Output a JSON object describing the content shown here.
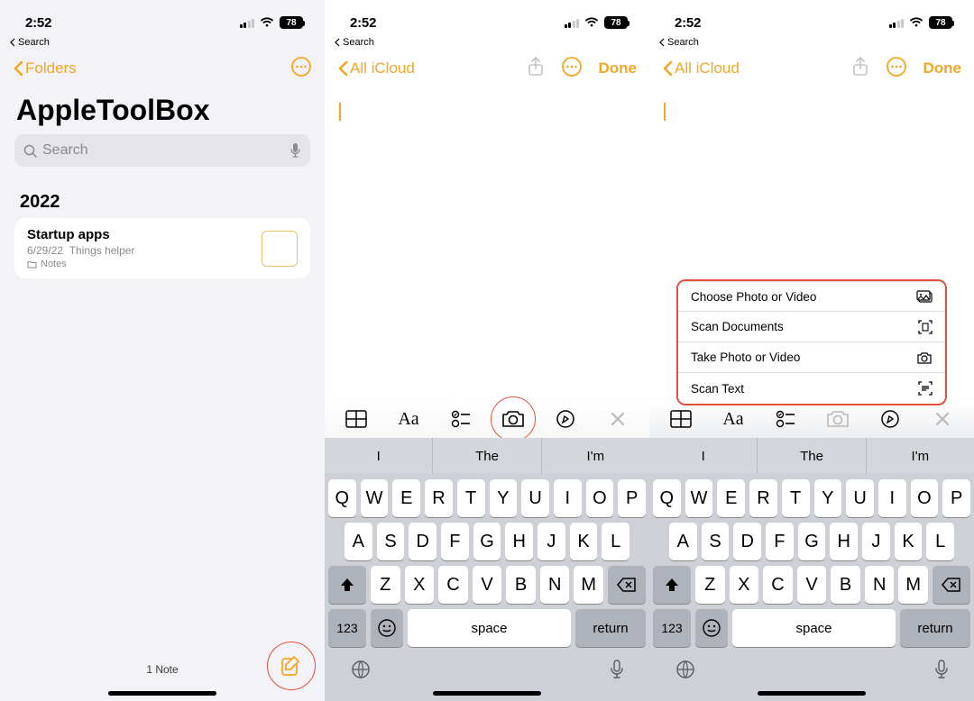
{
  "status": {
    "time": "2:52",
    "battery": "78"
  },
  "back_search": "Search",
  "screen1": {
    "back_label": "Folders",
    "title": "AppleToolBox",
    "search_placeholder": "Search",
    "year": "2022",
    "note": {
      "title": "Startup apps",
      "date": "6/29/22",
      "preview": "Things helper",
      "folder": "Notes"
    },
    "note_count": "1 Note"
  },
  "editor": {
    "back_label": "All iCloud",
    "done": "Done",
    "toolbar": {
      "aa": "Aa"
    },
    "suggestions": [
      "I",
      "The",
      "I'm"
    ],
    "keys_row1": [
      "Q",
      "W",
      "E",
      "R",
      "T",
      "Y",
      "U",
      "I",
      "O",
      "P"
    ],
    "keys_row2": [
      "A",
      "S",
      "D",
      "F",
      "G",
      "H",
      "J",
      "K",
      "L"
    ],
    "keys_row3": [
      "Z",
      "X",
      "C",
      "V",
      "B",
      "N",
      "M"
    ],
    "fn123": "123",
    "space": "space",
    "return": "return"
  },
  "menu": {
    "items": [
      "Choose Photo or Video",
      "Scan Documents",
      "Take Photo or Video",
      "Scan Text"
    ]
  }
}
